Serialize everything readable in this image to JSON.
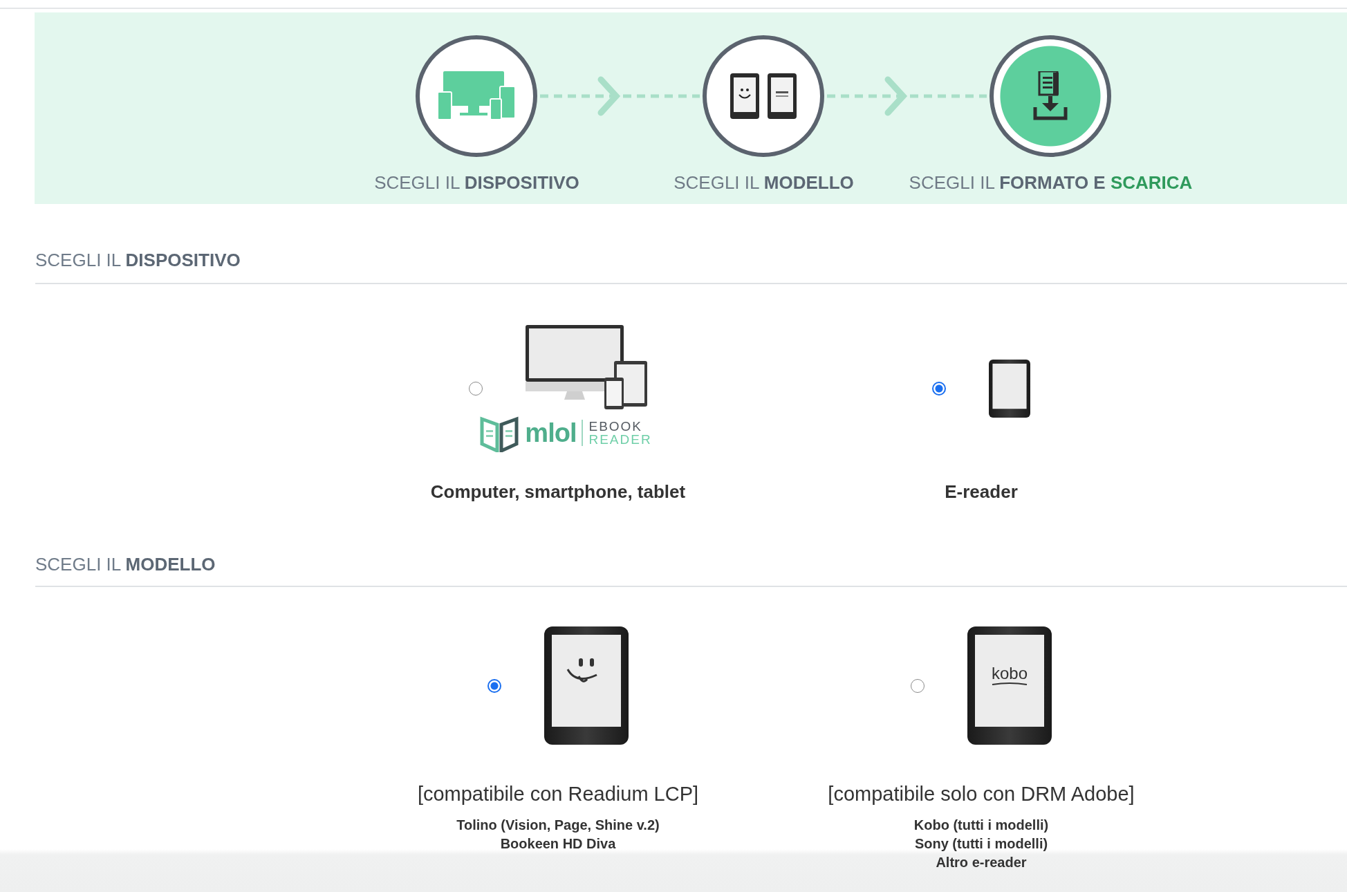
{
  "steps": [
    {
      "kind": "devices",
      "current": false,
      "label": "SCEGLI IL **DISPOSITIVO**"
    },
    {
      "kind": "ereaders",
      "current": false,
      "label": "SCEGLI IL **MODELLO**"
    },
    {
      "kind": "download",
      "current": true,
      "label": "SCEGLI IL **FORMATO E**",
      "accent": "SCARICA"
    }
  ],
  "sections": [
    {
      "kind": "device",
      "heading": "SCEGLI IL **DISPOSITIVO**",
      "options": [
        {
          "kind": "multi-device",
          "selected": false,
          "title": "Computer, smartphone, tablet",
          "logo": {
            "wordmark": "mlol",
            "line_1": "EBOOK",
            "line_2": "READER"
          }
        },
        {
          "kind": "ereader",
          "selected": true,
          "title": "E-reader"
        }
      ]
    },
    {
      "kind": "model",
      "heading": "SCEGLI IL **MODELLO**",
      "options": [
        {
          "kind": "smiley-ereader",
          "selected": true,
          "title": "[compatibile con Readium LCP]",
          "lines": [
            "Tolino (Vision, Page, Shine v.2)",
            "Bookeen HD Diva"
          ]
        },
        {
          "kind": "kobo-ereader",
          "selected": false,
          "title": "[compatibile solo con DRM Adobe]",
          "screen_text": "kobo",
          "lines": [
            "Kobo (tutti i modelli)",
            "Sony (tutti i modelli)",
            "Altro e-reader"
          ]
        }
      ]
    }
  ]
}
